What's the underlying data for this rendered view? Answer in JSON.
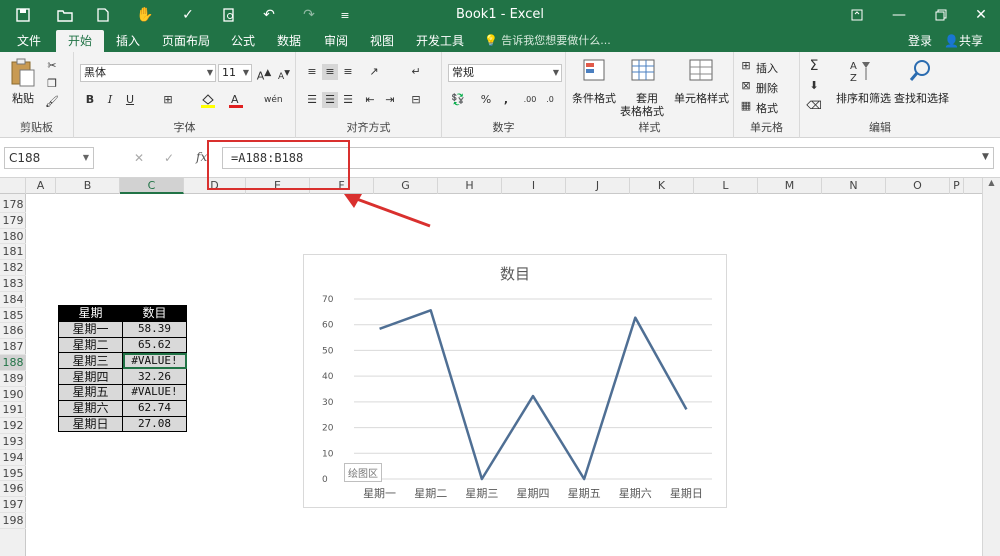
{
  "window": {
    "title": "Book1 - Excel"
  },
  "tabs": [
    "文件",
    "开始",
    "插入",
    "页面布局",
    "公式",
    "数据",
    "审阅",
    "视图",
    "开发工具"
  ],
  "tell_me": "告诉我您想要做什么...",
  "account": {
    "login": "登录",
    "share": "共享"
  },
  "ribbon": {
    "clipboard": {
      "paste": "粘贴",
      "label": "剪贴板"
    },
    "font": {
      "name": "黑体",
      "size": "11",
      "label": "字体"
    },
    "alignment": {
      "label": "对齐方式"
    },
    "number": {
      "format": "常规",
      "label": "数字"
    },
    "styles": {
      "conditional": "条件格式",
      "table_line1": "套用",
      "table_line2": "表格格式",
      "cell_styles": "单元格样式",
      "label": "样式"
    },
    "cells": {
      "insert": "插入",
      "delete": "删除",
      "format": "格式",
      "label": "单元格"
    },
    "editing": {
      "sort": "排序和筛选",
      "find": "查找和选择",
      "label": "编辑"
    }
  },
  "formula_bar": {
    "name_box": "C188",
    "formula": "=A188:B188",
    "fx": "fx"
  },
  "columns": [
    "A",
    "B",
    "C",
    "D",
    "E",
    "F",
    "G",
    "H",
    "I",
    "J",
    "K",
    "L",
    "M",
    "N",
    "O",
    "P"
  ],
  "rows": [
    "178",
    "179",
    "180",
    "181",
    "182",
    "183",
    "184",
    "185",
    "186",
    "187",
    "188",
    "189",
    "190",
    "191",
    "192",
    "193",
    "194",
    "195",
    "196",
    "197",
    "198"
  ],
  "table": {
    "headers": [
      "星期",
      "数目"
    ],
    "rows": [
      [
        "星期一",
        "58.39"
      ],
      [
        "星期二",
        "65.62"
      ],
      [
        "星期三",
        "#VALUE!"
      ],
      [
        "星期四",
        "32.26"
      ],
      [
        "星期五",
        "#VALUE!"
      ],
      [
        "星期六",
        "62.74"
      ],
      [
        "星期日",
        "27.08"
      ]
    ]
  },
  "chart_data": {
    "type": "line",
    "title": "数目",
    "categories": [
      "星期一",
      "星期二",
      "星期三",
      "星期四",
      "星期五",
      "星期六",
      "星期日"
    ],
    "series": [
      {
        "values": [
          58.39,
          65.62,
          0,
          32.26,
          0,
          62.74,
          27.08
        ]
      }
    ],
    "yticks": [
      "0",
      "10",
      "20",
      "30",
      "40",
      "50",
      "60",
      "70"
    ],
    "ylim": [
      0,
      70
    ],
    "grid": true,
    "line_color": "#4f6f94",
    "plot_area_label": "绘图区"
  }
}
